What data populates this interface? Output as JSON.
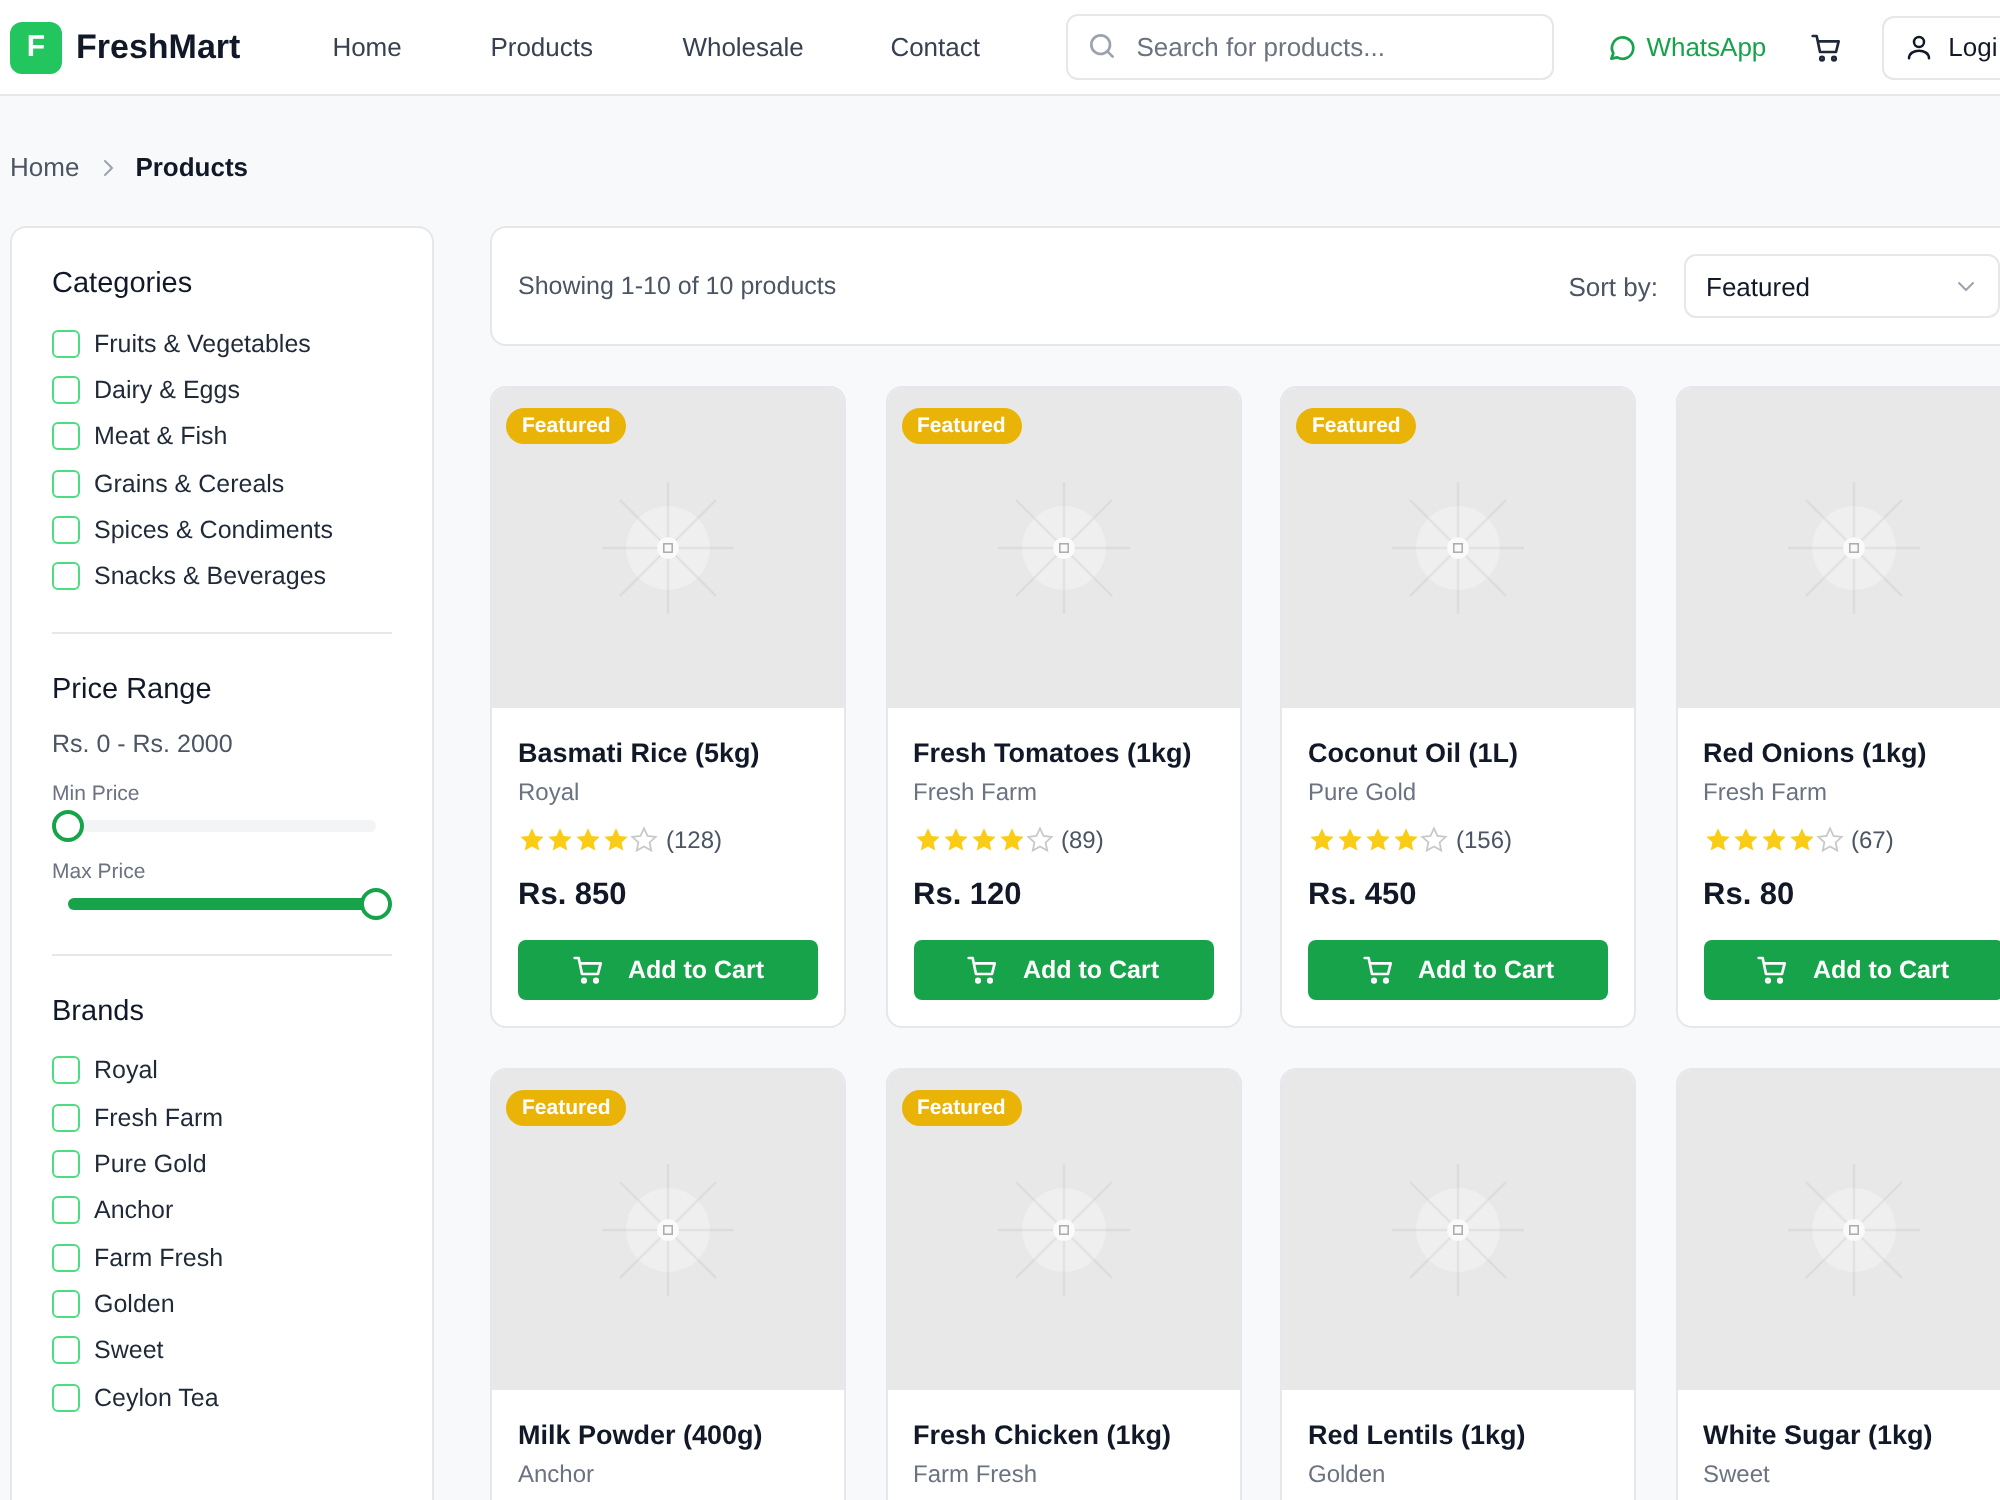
{
  "header": {
    "logo_letter": "F",
    "brand": "FreshMart",
    "nav": [
      "Home",
      "Products",
      "Wholesale",
      "Contact"
    ],
    "search": {
      "placeholder": "Search for products..."
    },
    "whatsapp": "WhatsApp",
    "login": "Logi"
  },
  "breadcrumb": [
    "Home",
    "Products"
  ],
  "filters": {
    "categories": {
      "title": "Categories",
      "items": [
        {
          "label": "Fruits & Vegetables",
          "checked": false
        },
        {
          "label": "Dairy & Eggs",
          "checked": false
        },
        {
          "label": "Meat & Fish",
          "checked": false
        },
        {
          "label": "Grains & Cereals",
          "checked": false
        },
        {
          "label": "Spices & Condiments",
          "checked": false
        },
        {
          "label": "Snacks & Beverages",
          "checked": false
        }
      ]
    },
    "price": {
      "title": "Price Range",
      "range_text": "Rs. 0 - Rs. 2000",
      "sliders": [
        {
          "label": "Min Price",
          "level": 0
        },
        {
          "label": "Max Price",
          "level": 1
        }
      ]
    },
    "brands": {
      "title": "Brands",
      "items": [
        {
          "label": "Royal",
          "checked": false
        },
        {
          "label": "Fresh Farm",
          "checked": false
        },
        {
          "label": "Pure Gold",
          "checked": false
        },
        {
          "label": "Anchor",
          "checked": false
        },
        {
          "label": "Farm Fresh",
          "checked": false
        },
        {
          "label": "Golden",
          "checked": false
        },
        {
          "label": "Sweet",
          "checked": false
        },
        {
          "label": "Ceylon Tea",
          "checked": false
        }
      ]
    }
  },
  "toolbar": {
    "showing": "Showing 1-10 of 10 products",
    "sort_label": "Sort by:",
    "sort_value": "Featured"
  },
  "products": [
    {
      "name": "Basmati Rice (5kg)",
      "brand": "Royal",
      "stars": 4,
      "reviews": "(128)",
      "price": "Rs. 850",
      "badge": "Featured",
      "featured": true,
      "button": "Add to Cart"
    },
    {
      "name": "Fresh Tomatoes (1kg)",
      "brand": "Fresh Farm",
      "stars": 4,
      "reviews": "(89)",
      "price": "Rs. 120",
      "badge": "Featured",
      "featured": true,
      "button": "Add to Cart"
    },
    {
      "name": "Coconut Oil (1L)",
      "brand": "Pure Gold",
      "stars": 4,
      "reviews": "(156)",
      "price": "Rs. 450",
      "badge": "Featured",
      "featured": true,
      "button": "Add to Cart"
    },
    {
      "name": "Red Onions (1kg)",
      "brand": "Fresh Farm",
      "stars": 4,
      "reviews": "(67)",
      "price": "Rs. 80",
      "featured": false,
      "button": "Add to Cart"
    },
    {
      "name": "Milk Powder (400g)",
      "brand": "Anchor",
      "badge": "Featured",
      "featured": true
    },
    {
      "name": "Fresh Chicken (1kg)",
      "brand": "Farm Fresh",
      "badge": "Featured",
      "featured": true
    },
    {
      "name": "Red Lentils (1kg)",
      "brand": "Golden",
      "featured": false
    },
    {
      "name": "White Sugar (1kg)",
      "brand": "Sweet",
      "featured": false
    }
  ]
}
